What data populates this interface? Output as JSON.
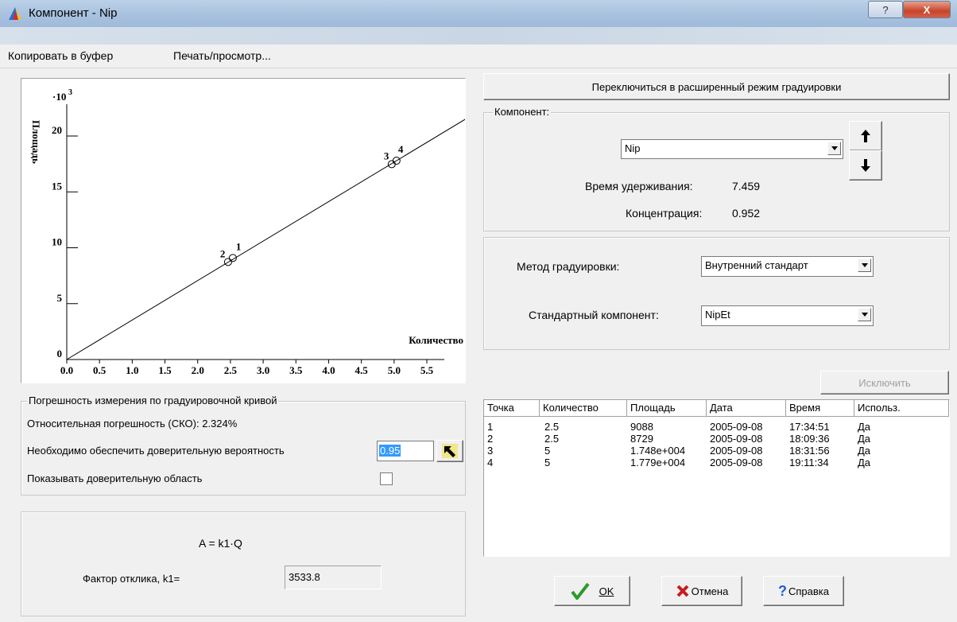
{
  "window": {
    "title": "Компонент - Nip",
    "help_label": "?",
    "close_label": "X"
  },
  "menu": {
    "copy": "Копировать в буфер",
    "print": "Печать/просмотр..."
  },
  "chart_data": {
    "type": "scatter",
    "title": "",
    "xlabel": "Количество",
    "ylabel": "Площадь",
    "y_multiplier": "·10",
    "y_multiplier_exp": "3",
    "xlim": [
      0,
      5.5
    ],
    "ylim": [
      0,
      20
    ],
    "x_ticks": [
      "0.0",
      "0.5",
      "1.0",
      "1.5",
      "2.0",
      "2.5",
      "3.0",
      "3.5",
      "4.0",
      "4.5",
      "5.0",
      "5.5"
    ],
    "y_ticks": [
      "0",
      "5",
      "10",
      "15",
      "20"
    ],
    "points": [
      {
        "label": "1",
        "x": 2.5,
        "y": 9.088
      },
      {
        "label": "2",
        "x": 2.5,
        "y": 8.729
      },
      {
        "label": "3",
        "x": 5,
        "y": 17.48
      },
      {
        "label": "4",
        "x": 5,
        "y": 17.79
      }
    ],
    "fit_line": {
      "x": [
        0,
        6.2
      ],
      "y": [
        0,
        21.9
      ]
    }
  },
  "error_group": {
    "title": "Погрешность измерения по градуировочной кривой",
    "relative_error": "Относительная погрешность (СКО): 2.324%",
    "confidence_label": "Необходимо обеспечить доверительную вероятность",
    "confidence_value": "0.95",
    "show_region_label": "Показывать доверительную область"
  },
  "formula": {
    "equation": "A = k1·Q",
    "factor_label": "Фактор отклика,  k1=",
    "factor_value": "3533.8"
  },
  "switch_button": "Переключиться в расширенный режим градуировки",
  "component_group": {
    "title": "Компонент:",
    "selected": "Nip",
    "retention_label": "Время удерживания:",
    "retention_value": "7.459",
    "concentration_label": "Концентрация:",
    "concentration_value": "0.952"
  },
  "method_group": {
    "method_label": "Метод градуировки:",
    "method_value": "Внутренний стандарт",
    "standard_label": "Стандартный компонент:",
    "standard_value": "NipEt"
  },
  "exclude_button": "Исключить",
  "table": {
    "headers": [
      "Точка",
      "Количество",
      "Площадь",
      "Дата",
      "Время",
      "Использ."
    ],
    "rows": [
      [
        "1",
        "2.5",
        "9088",
        "2005-09-08",
        "17:34:51",
        "Да"
      ],
      [
        "2",
        "2.5",
        "8729",
        "2005-09-08",
        "18:09:36",
        "Да"
      ],
      [
        "3",
        "5",
        "1.748e+004",
        "2005-09-08",
        "18:31:56",
        "Да"
      ],
      [
        "4",
        "5",
        "1.779e+004",
        "2005-09-08",
        "19:11:34",
        "Да"
      ]
    ]
  },
  "buttons": {
    "ok": "OK",
    "cancel": "Отмена",
    "help": "Справка"
  }
}
